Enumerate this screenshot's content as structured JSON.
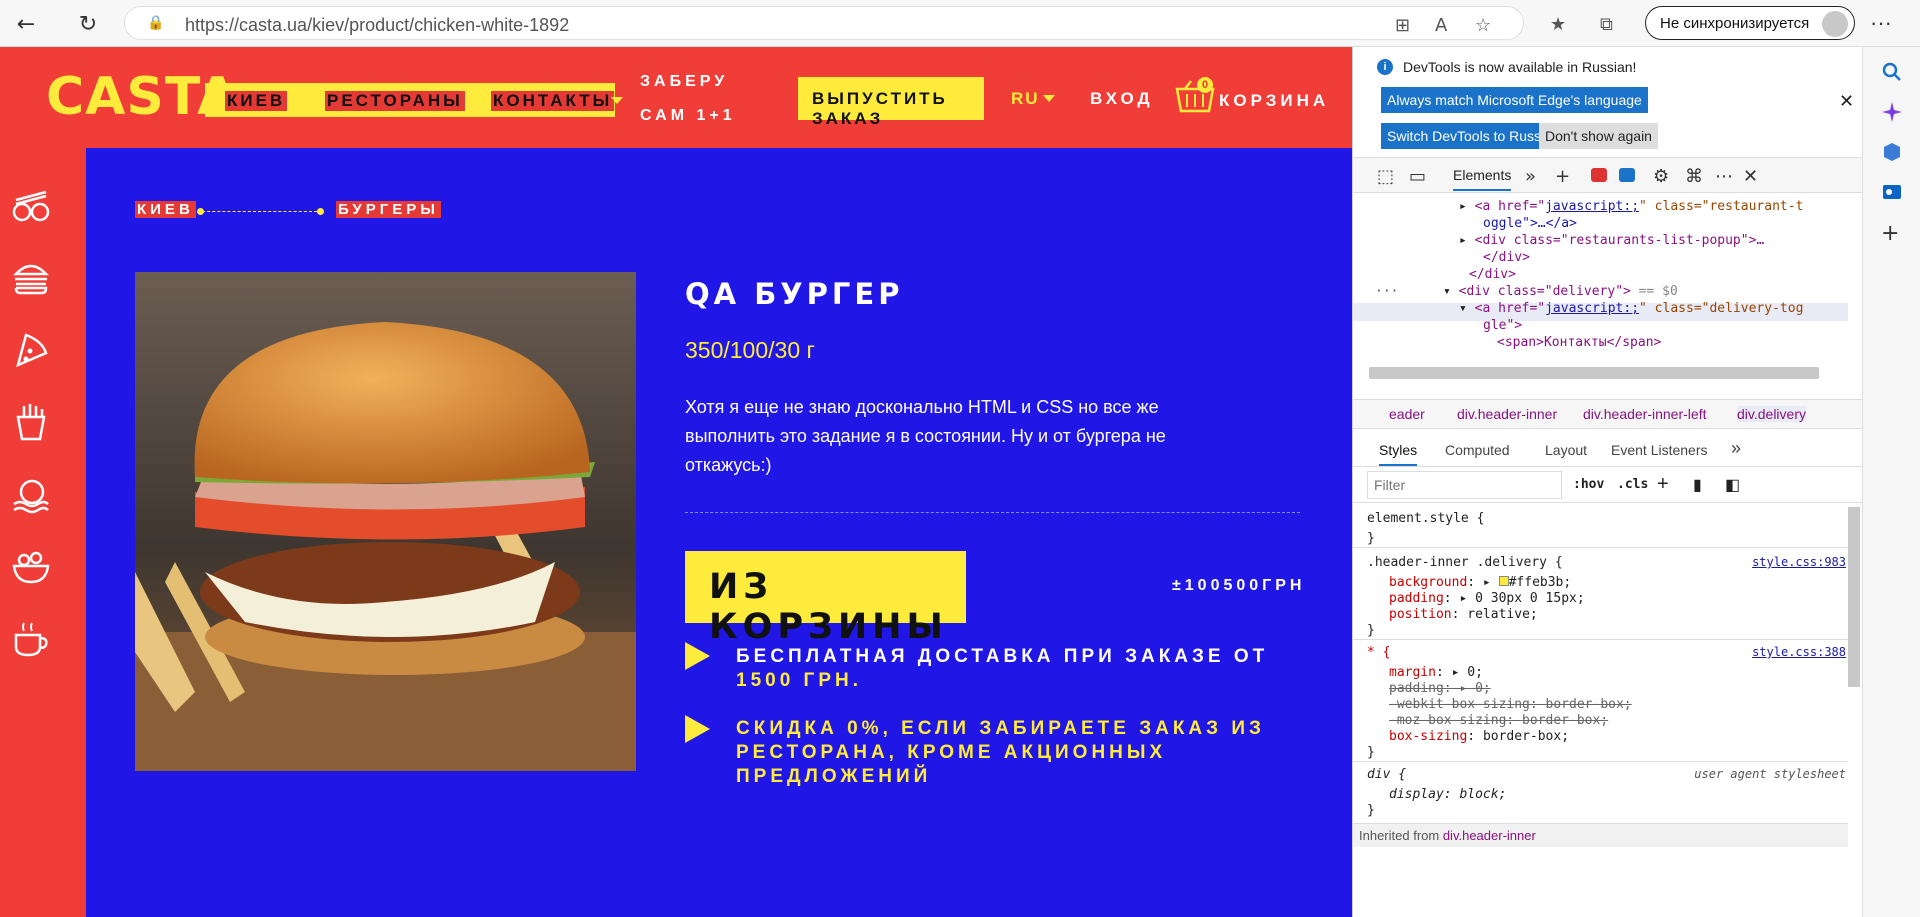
{
  "browser": {
    "url": "https://casta.ua/kiev/product/chicken-white-1892",
    "sync_label": "Не синхронизируется"
  },
  "site": {
    "logo": "CASTA",
    "nav": [
      "КИЕВ",
      "РЕСТОРАНЫ",
      "КОНТАКТЫ"
    ],
    "pickup_line1": "ЗАБЕРУ",
    "pickup_line2": "САМ 1+1",
    "order_button": "ВЫПУСТИТЬ ЗАКАЗ",
    "lang": "RU",
    "login": "ВХОД",
    "cart_count": "0",
    "cart_label": "КОРЗИНА",
    "breadcrumb": [
      "КИЕВ",
      "БУРГЕРЫ"
    ],
    "product": {
      "title": "QA БУРГЕР",
      "weight": "350/100/30 г",
      "description": "Хотя я еще не знаю досконально HTML и CSS но все же выполнить это задание я в состоянии. Ну и от бургера не откажусь:)",
      "cart_button": "ИЗ КОРЗИНЫ",
      "price": "±100500ГРН",
      "benefit1_text": "БЕСПЛАТНАЯ ДОСТАВКА ПРИ ЗАКАЗЕ ОТ ",
      "benefit1_highlight": "1500 ГРН.",
      "benefit2_text": "СКИДКА 0%, ЕСЛИ ЗАБИРАЕТЕ ЗАКАЗ ИЗ РЕСТОРАНА, КРОМЕ АКЦИОННЫХ ПРЕДЛОЖЕНИЙ"
    },
    "sidebar_icons": [
      "sushi-icon",
      "burger-icon",
      "pizza-icon",
      "fries-icon",
      "hot-dish-icon",
      "salad-icon",
      "coffee-icon"
    ]
  },
  "devtools": {
    "notice": "DevTools is now available in Russian!",
    "btn_match": "Always match Microsoft Edge's language",
    "btn_switch": "Switch DevTools to Russian",
    "btn_dont_show": "Don't show again",
    "tab_elements": "Elements",
    "dom_lines": {
      "l1a": "<a href=\"",
      "l1b": "javascript:;",
      "l1c": "\" class=\"restaurant-t",
      "l2": "oggle\">…</a>",
      "l3": "<div class=\"restaurants-list-popup\">…",
      "l4": "</div>",
      "l5": "</div>",
      "l6": "<div class=\"delivery\">",
      "l6b": " == $0",
      "l7a": "<a href=\"",
      "l7b": "javascript:;",
      "l7c": "\" class=\"delivery-tog",
      "l8": "gle\">",
      "l9": "<span>Контакты</span>"
    },
    "crumbs": [
      "eader",
      "div.header-inner",
      "div.header-inner-left",
      "div.delivery"
    ],
    "subtabs": [
      "Styles",
      "Computed",
      "Layout",
      "Event Listeners"
    ],
    "filter_placeholder": "Filter",
    "hov": ":hov",
    "cls": ".cls",
    "styles": {
      "element_style": "element.style {",
      "close": "}",
      "rule1_selector": ".header-inner .delivery {",
      "rule1_src": "style.css:983",
      "r1_bg_name": "background",
      "r1_bg_val": "#ffeb3b;",
      "r1_pad_name": "padding",
      "r1_pad_val": "0 30px 0 15px;",
      "r1_pos_name": "position",
      "r1_pos_val": "relative;",
      "rule2_selector": "* {",
      "rule2_src": "style.css:388",
      "r2_margin_name": "margin",
      "r2_margin_val": "0;",
      "r2_padding_name": "padding",
      "r2_padding_val": "0;",
      "r2_webkit": "-webkit-box-sizing: border-box;",
      "r2_moz": "-moz-box-sizing: border-box;",
      "r2_bs_name": "box-sizing",
      "r2_bs_val": "border-box;",
      "rule3_selector": "div {",
      "rule3_src": "user agent stylesheet",
      "r3_display": "display: block;",
      "inherited": "Inherited from ",
      "inherited_link": "div.header-inner"
    }
  }
}
